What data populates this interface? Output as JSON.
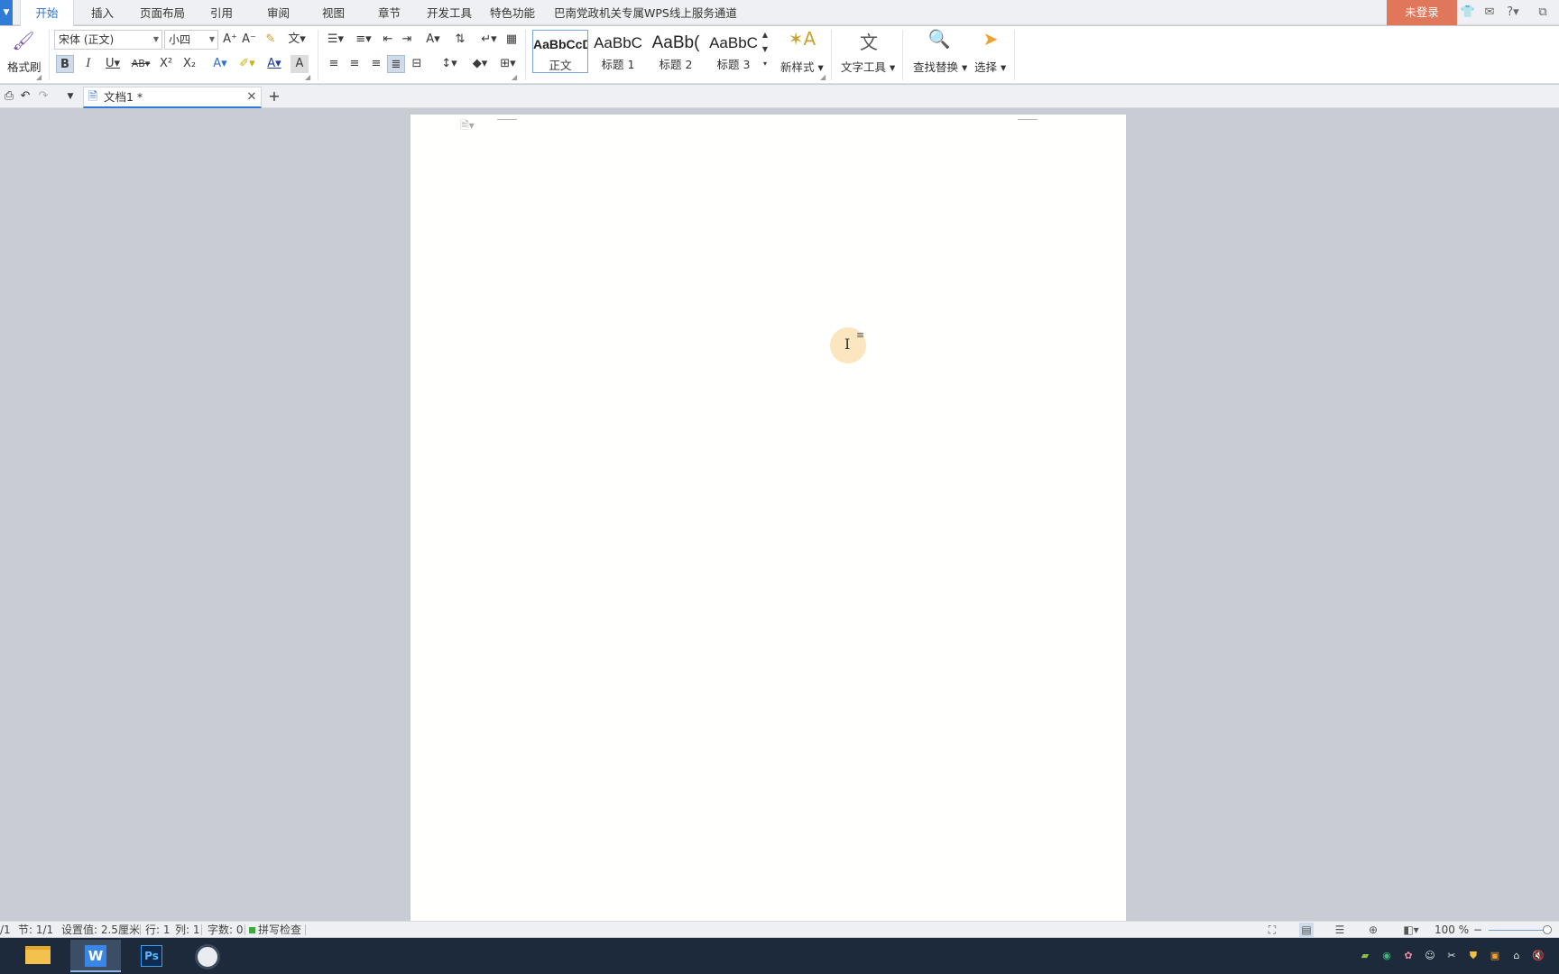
{
  "menubar": {
    "items": [
      "开始",
      "插入",
      "页面布局",
      "引用",
      "审阅",
      "视图",
      "章节",
      "开发工具",
      "特色功能",
      "巴南党政机关专属WPS线上服务通道"
    ],
    "login_label": "未登录"
  },
  "ribbon": {
    "format_painter_label": "格式刷",
    "font_name": "宋体 (正文)",
    "font_size": "小四",
    "styles": [
      {
        "sample": "AaBbCcD",
        "name": "正文"
      },
      {
        "sample": "AaBbC",
        "name": "标题 1"
      },
      {
        "sample": "AaBb(",
        "name": "标题 2"
      },
      {
        "sample": "AaBbC",
        "name": "标题 3"
      }
    ],
    "new_style_label": "新样式",
    "text_tools_label": "文字工具",
    "find_replace_label": "查找替换",
    "select_label": "选择"
  },
  "tabs": {
    "doc_title": "文档1 *"
  },
  "statusbar": {
    "page": "/1",
    "section": "节: 1/1",
    "setting": "设置值: 2.5厘米",
    "row": "行: 1",
    "col": "列: 1",
    "word_count": "字数: 0",
    "spell_check": "拼写检查",
    "zoom": "100 %"
  },
  "colors": {
    "accent": "#2f7bd6",
    "login": "#e0775a",
    "taskbar": "#1c2a3b"
  }
}
